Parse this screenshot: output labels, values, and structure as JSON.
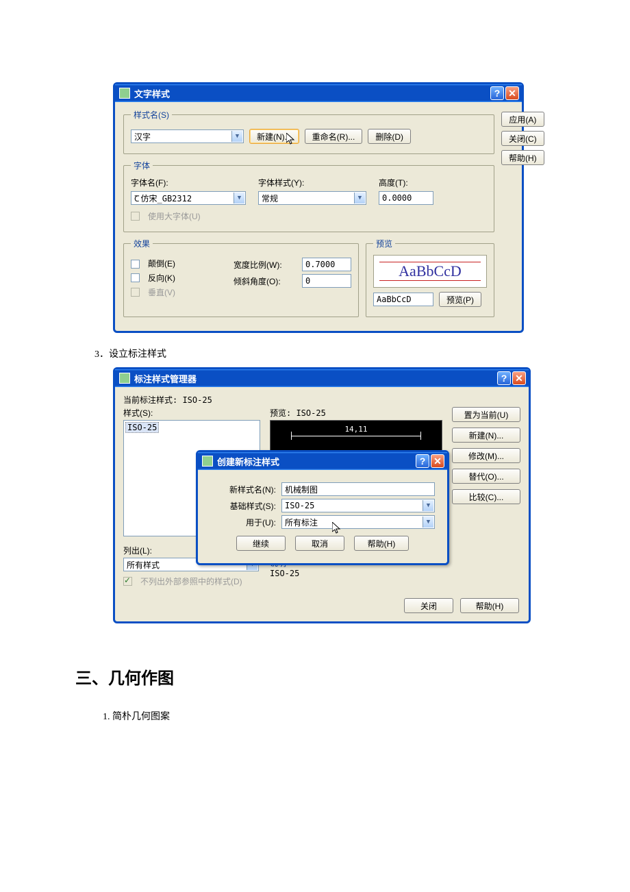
{
  "text_style_dialog": {
    "title": "文字样式",
    "style_name_group": "样式名(S)",
    "style_name_value": "汉字",
    "btn_new": "新建(N)...",
    "btn_rename": "重命名(R)...",
    "btn_delete": "删除(D)",
    "font_group": "字体",
    "font_name_label": "字体名(F):",
    "font_name_value": "仿宋_GB2312",
    "font_style_label": "字体样式(Y):",
    "font_style_value": "常规",
    "height_label": "高度(T):",
    "height_value": "0.0000",
    "big_font_label": "使用大字体(U)",
    "effects_group": "效果",
    "upside_down_label": "颠倒(E)",
    "backwards_label": "反向(K)",
    "vertical_label": "垂直(V)",
    "width_factor_label": "宽度比例(W):",
    "width_factor_value": "0.7000",
    "oblique_label": "倾斜角度(O):",
    "oblique_value": "0",
    "preview_group": "预览",
    "preview_sample": "AaBbCcD",
    "preview_input": "AaBbCcD",
    "btn_preview": "预览(P)",
    "btn_apply": "应用(A)",
    "btn_close": "关闭(C)",
    "btn_help": "帮助(H)"
  },
  "doc": {
    "item3": "3．设立标注样式",
    "heading3": "三、几何作图",
    "sub1": "1. 简朴几何图案"
  },
  "dim_dialog": {
    "title": "标注样式管理器",
    "current_label": "当前标注样式: ISO-25",
    "styles_label": "样式(S):",
    "list_selected": "ISO-25",
    "preview_label": "预览: ISO-25",
    "preview_dim": "14,11",
    "btn_set_current": "置为当前(U)",
    "btn_new": "新建(N)...",
    "btn_modify": "修改(M)...",
    "btn_override": "替代(O)...",
    "btn_compare": "比较(C)...",
    "list_filter_label": "列出(L):",
    "list_filter_value": "所有样式",
    "no_xref_label": "不列出外部参照中的样式(D)",
    "desc_partial": "ISO-25",
    "btn_close": "关闭",
    "btn_help": "帮助(H)"
  },
  "new_style_modal": {
    "title": "创建新标注样式",
    "new_name_label": "新样式名(N):",
    "new_name_value": "机械制图",
    "base_label": "基础样式(S):",
    "base_value": "ISO-25",
    "use_for_label": "用于(U):",
    "use_for_value": "所有标注",
    "btn_continue": "继续",
    "btn_cancel": "取消",
    "btn_help": "帮助(H)"
  }
}
